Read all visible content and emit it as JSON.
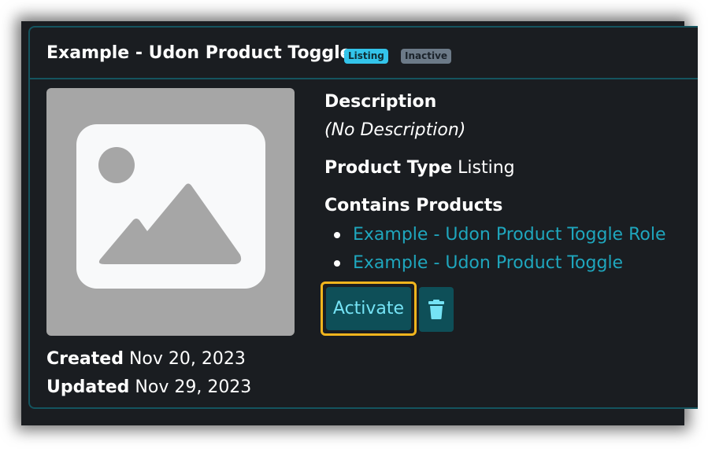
{
  "card": {
    "title": "Example - Udon Product Toggle",
    "badges": {
      "type": "Listing",
      "status": "Inactive"
    }
  },
  "thumbnail": {
    "icon": "image-placeholder-icon"
  },
  "dates": {
    "created_label": "Created",
    "created_value": "Nov 20, 2023",
    "updated_label": "Updated",
    "updated_value": "Nov 29, 2023"
  },
  "details": {
    "description_label": "Description",
    "description_value": "(No Description)",
    "product_type_label": "Product Type",
    "product_type_value": "Listing",
    "contains_label": "Contains Products",
    "products": [
      "Example - Udon Product Toggle Role",
      "Example - Udon Product Toggle"
    ]
  },
  "actions": {
    "activate_label": "Activate",
    "delete_icon": "trash-icon"
  },
  "colors": {
    "accent": "#1fa6bd",
    "focus_ring": "#f2b51d",
    "card_border": "#14545f",
    "background": "#1a1d21"
  }
}
